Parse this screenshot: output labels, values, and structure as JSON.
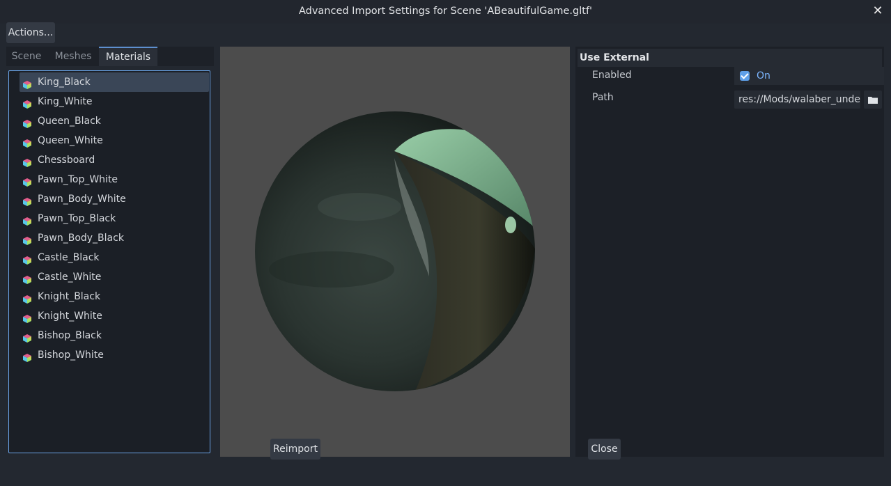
{
  "window": {
    "title": "Advanced Import Settings for Scene 'ABeautifulGame.gltf'",
    "close_icon": "close-icon"
  },
  "toolbar": {
    "actions_label": "Actions..."
  },
  "tabs": [
    {
      "label": "Scene",
      "active": false
    },
    {
      "label": "Meshes",
      "active": false
    },
    {
      "label": "Materials",
      "active": true
    }
  ],
  "materials": [
    {
      "label": "King_Black",
      "selected": true
    },
    {
      "label": "King_White"
    },
    {
      "label": "Queen_Black"
    },
    {
      "label": "Queen_White"
    },
    {
      "label": "Chessboard"
    },
    {
      "label": "Pawn_Top_White"
    },
    {
      "label": "Pawn_Body_White"
    },
    {
      "label": "Pawn_Top_Black"
    },
    {
      "label": "Pawn_Body_Black"
    },
    {
      "label": "Castle_Black"
    },
    {
      "label": "Castle_White"
    },
    {
      "label": "Knight_Black"
    },
    {
      "label": "Knight_White"
    },
    {
      "label": "Bishop_Black"
    },
    {
      "label": "Bishop_White"
    }
  ],
  "inspector": {
    "section_title": "Use External",
    "enabled": {
      "label": "Enabled",
      "checked": true,
      "value_label": "On"
    },
    "path": {
      "label": "Path",
      "value": "res://Mods/walaber_under"
    }
  },
  "footer": {
    "reimport_label": "Reimport",
    "close_label": "Close"
  },
  "colors": {
    "accent": "#5fa0ea",
    "selected_row": "#3a4657",
    "viewport_bg": "#4c4c4c"
  }
}
